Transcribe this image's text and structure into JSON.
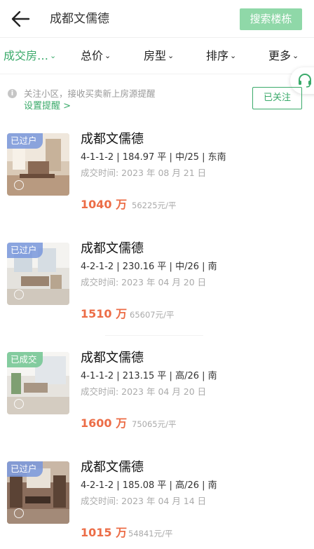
{
  "header": {
    "search_text": "成都文儒德",
    "search_button": "搜索楼栋"
  },
  "filters": [
    {
      "label": "成交房…",
      "active": true
    },
    {
      "label": "总价",
      "active": false
    },
    {
      "label": "房型",
      "active": false
    },
    {
      "label": "排序",
      "active": false
    },
    {
      "label": "更多",
      "active": false
    }
  ],
  "caret": "⌄",
  "notice": {
    "info_glyph": "i",
    "text": "关注小区，接收买卖新上房源提醒",
    "link": "设置提醒 >",
    "follow_button": "已关注"
  },
  "listings": [
    {
      "badge": "已过户",
      "title": "成都文儒德",
      "detail": "4-1-1-2 | 184.97 平 | 中/25 | 东南",
      "deal_time": "成交时间:  2023 年 08 月 21 日",
      "price": "1040 万",
      "unit_price": "56225元/平"
    },
    {
      "badge": "已过户",
      "title": "成都文儒德",
      "detail": "4-2-1-2 | 230.16 平 | 中/26 | 南",
      "deal_time": "成交时间:  2023 年 04 月 20 日",
      "price": "1510 万",
      "unit_price": "65607元/平"
    },
    {
      "badge": "已成交",
      "title": "成都文儒德",
      "detail": "4-1-1-2 | 213.15 平 | 高/26 | 南",
      "deal_time": "成交时间:  2023 年 04 月 20 日",
      "price": "1600 万",
      "unit_price": "75065元/平"
    },
    {
      "badge": "已过户",
      "title": "成都文儒德",
      "detail": "4-2-1-2 | 185.08 平 | 高/26 | 南",
      "deal_time": "成交时间:  2023 年 04 月 14 日",
      "price": "1015 万",
      "unit_price": "54841元/平"
    }
  ],
  "colors": {
    "accent": "#3aaa6a",
    "price": "#ec6d47",
    "search_button": "#8fd8a8"
  },
  "icons": {
    "back": "arrow-left-icon",
    "service": "headset-icon",
    "info": "info-icon",
    "vr": "vr-icon"
  }
}
